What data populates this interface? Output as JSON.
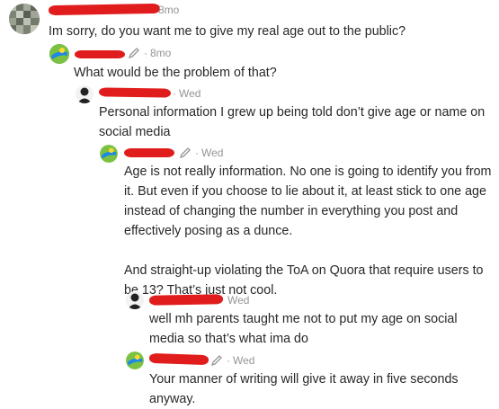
{
  "comments": [
    {
      "time": "8mo",
      "text": [
        "Im sorry, do you want me to give my real age out to the public?"
      ]
    },
    {
      "time": "8mo",
      "text": [
        "What would be the problem of that?"
      ]
    },
    {
      "time": "Wed",
      "text": [
        "Personal information I grew up being told don’t give age or name on social media"
      ]
    },
    {
      "time": "Wed",
      "text": [
        "Age is not really information. No one is going to identify you from it. But even if you choose to lie about it, at least stick to one age instead of changing the number in everything you post and effectively posing as a dunce.",
        "And straight-up violating the ToA on Quora that require users to be 13? That’s just not cool."
      ]
    },
    {
      "time": "Wed",
      "text": [
        "well mh parents taught me not to put my age on social media so that’s what ima do"
      ]
    },
    {
      "time": "Wed",
      "text": [
        "Your manner of writing will give it away in five seconds anyway."
      ]
    }
  ],
  "separator": "·",
  "icons": {
    "edited": "pencil-icon",
    "avatar_1": "pixel-art-avatar",
    "avatar_2": "globe-icon",
    "avatar_3": "silhouette-avatar"
  },
  "colors": {
    "text": "#282829",
    "meta": "#939598",
    "redaction": "#e01c1c"
  }
}
